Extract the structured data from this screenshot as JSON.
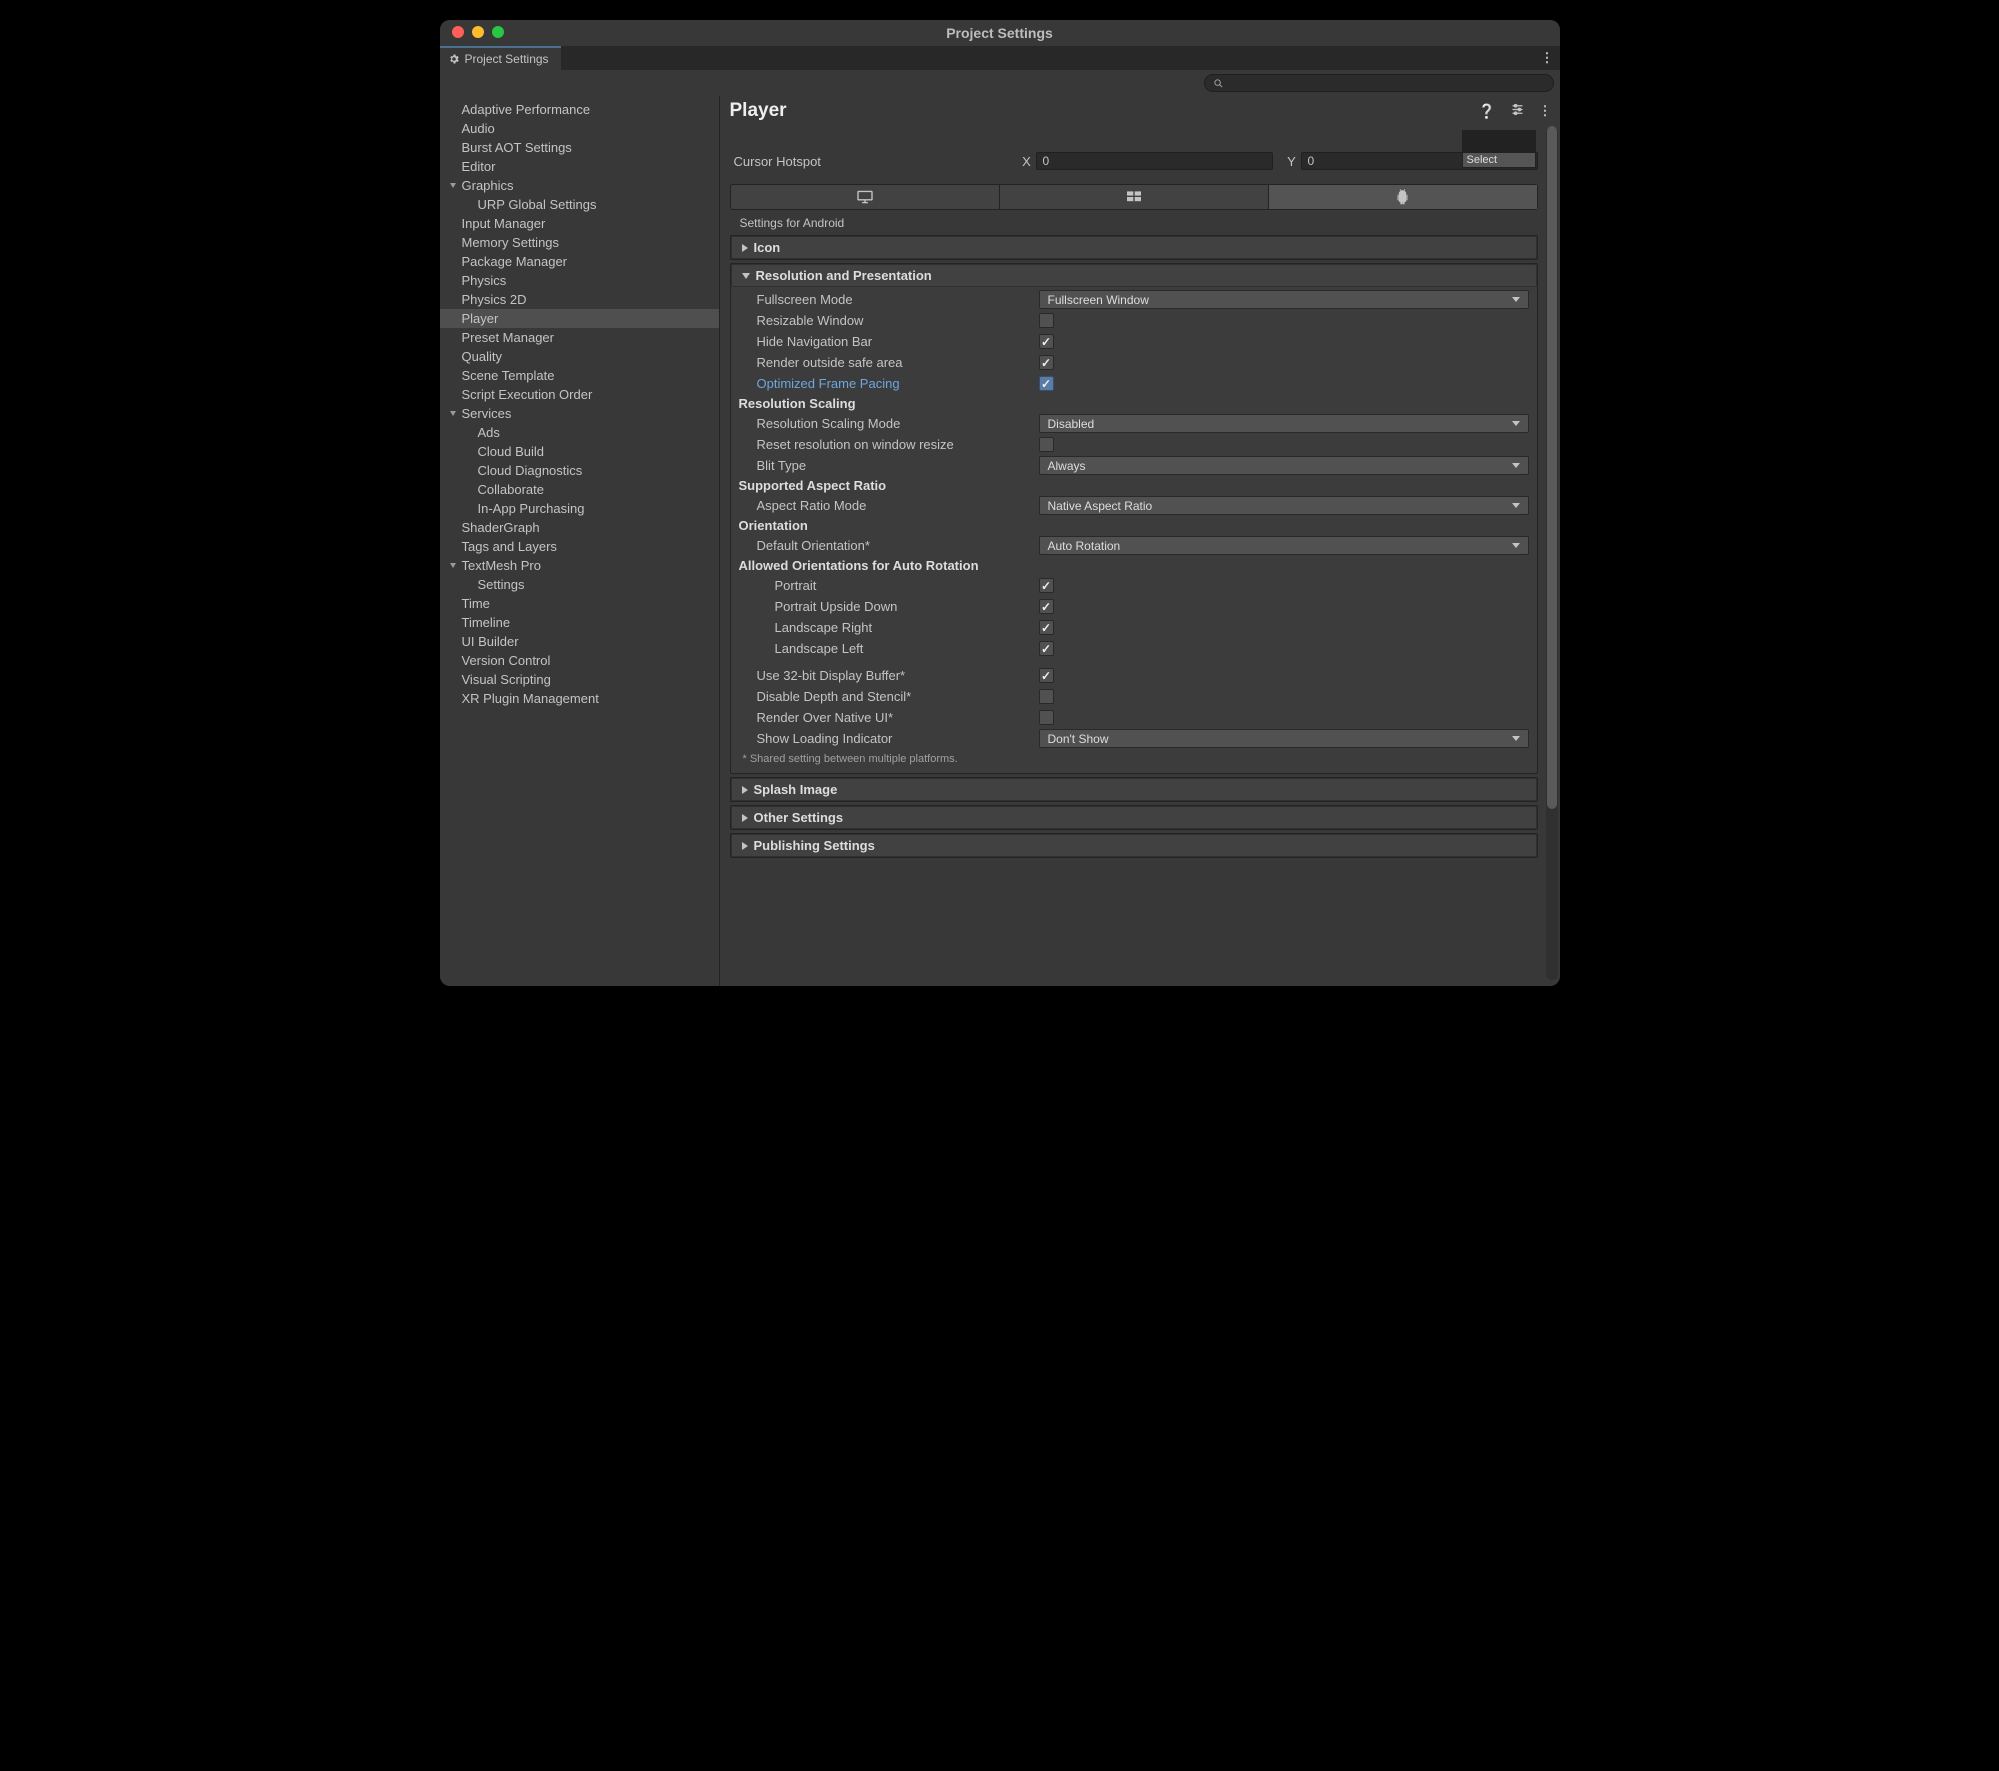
{
  "window_title": "Project Settings",
  "tab_label": "Project Settings",
  "select_box_label": "Select",
  "sidebar": {
    "items": [
      {
        "label": "Adaptive Performance",
        "level": 1
      },
      {
        "label": "Audio",
        "level": 1
      },
      {
        "label": "Burst AOT Settings",
        "level": 1
      },
      {
        "label": "Editor",
        "level": 1
      },
      {
        "label": "Graphics",
        "level": 1,
        "expand": true
      },
      {
        "label": "URP Global Settings",
        "level": 2
      },
      {
        "label": "Input Manager",
        "level": 1
      },
      {
        "label": "Memory Settings",
        "level": 1
      },
      {
        "label": "Package Manager",
        "level": 1
      },
      {
        "label": "Physics",
        "level": 1
      },
      {
        "label": "Physics 2D",
        "level": 1
      },
      {
        "label": "Player",
        "level": 1,
        "selected": true
      },
      {
        "label": "Preset Manager",
        "level": 1
      },
      {
        "label": "Quality",
        "level": 1
      },
      {
        "label": "Scene Template",
        "level": 1
      },
      {
        "label": "Script Execution Order",
        "level": 1
      },
      {
        "label": "Services",
        "level": 1,
        "expand": true
      },
      {
        "label": "Ads",
        "level": 2
      },
      {
        "label": "Cloud Build",
        "level": 2
      },
      {
        "label": "Cloud Diagnostics",
        "level": 2
      },
      {
        "label": "Collaborate",
        "level": 2
      },
      {
        "label": "In-App Purchasing",
        "level": 2
      },
      {
        "label": "ShaderGraph",
        "level": 1
      },
      {
        "label": "Tags and Layers",
        "level": 1
      },
      {
        "label": "TextMesh Pro",
        "level": 1,
        "expand": true
      },
      {
        "label": "Settings",
        "level": 2
      },
      {
        "label": "Time",
        "level": 1
      },
      {
        "label": "Timeline",
        "level": 1
      },
      {
        "label": "UI Builder",
        "level": 1
      },
      {
        "label": "Version Control",
        "level": 1
      },
      {
        "label": "Visual Scripting",
        "level": 1
      },
      {
        "label": "XR Plugin Management",
        "level": 1
      }
    ]
  },
  "main": {
    "heading": "Player",
    "cursor_hotspot_label": "Cursor Hotspot",
    "cursor_x_label": "X",
    "cursor_y_label": "Y",
    "cursor_x": "0",
    "cursor_y": "0",
    "settings_for": "Settings for Android",
    "panel_icon": "Icon",
    "panel_res": "Resolution and Presentation",
    "fullscreen_mode_label": "Fullscreen Mode",
    "fullscreen_mode_value": "Fullscreen Window",
    "resizable_window_label": "Resizable Window",
    "resizable_window": false,
    "hide_nav_label": "Hide Navigation Bar",
    "hide_nav": true,
    "render_outside_label": "Render outside safe area",
    "render_outside": true,
    "opt_frame_pacing_label": "Optimized Frame Pacing",
    "opt_frame_pacing": true,
    "res_scaling_head": "Resolution Scaling",
    "res_scaling_mode_label": "Resolution Scaling Mode",
    "res_scaling_mode_value": "Disabled",
    "reset_res_label": "Reset resolution on window resize",
    "reset_res": false,
    "blit_type_label": "Blit Type",
    "blit_type_value": "Always",
    "aspect_head": "Supported Aspect Ratio",
    "aspect_mode_label": "Aspect Ratio Mode",
    "aspect_mode_value": "Native Aspect Ratio",
    "orientation_head": "Orientation",
    "default_orient_label": "Default Orientation*",
    "default_orient_value": "Auto Rotation",
    "allowed_orient_head": "Allowed Orientations for Auto Rotation",
    "portrait_label": "Portrait",
    "portrait": true,
    "portrait_ud_label": "Portrait Upside Down",
    "portrait_ud": true,
    "land_r_label": "Landscape Right",
    "land_r": true,
    "land_l_label": "Landscape Left",
    "land_l": true,
    "use32_label": "Use 32-bit Display Buffer*",
    "use32": true,
    "disable_depth_label": "Disable Depth and Stencil*",
    "disable_depth": false,
    "render_native_label": "Render Over Native UI*",
    "render_native": false,
    "loading_ind_label": "Show Loading Indicator",
    "loading_ind_value": "Don't Show",
    "footnote": "* Shared setting between multiple platforms.",
    "panel_splash": "Splash Image",
    "panel_other": "Other Settings",
    "panel_publish": "Publishing Settings"
  }
}
